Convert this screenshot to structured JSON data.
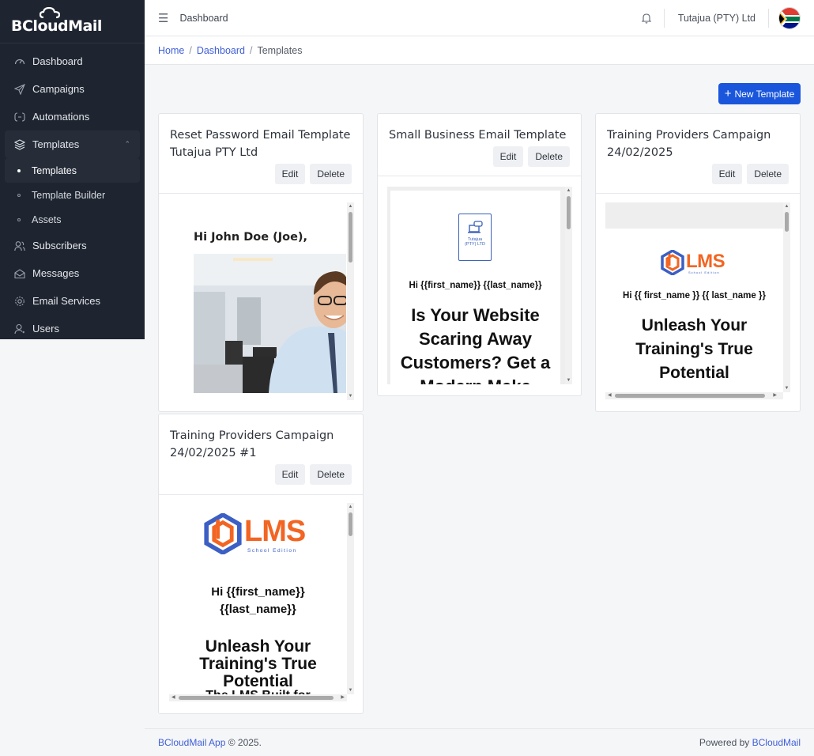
{
  "app": {
    "brand": "BCloudMail"
  },
  "sidebar": {
    "items": [
      {
        "label": "Dashboard",
        "icon": "dashboard-gauge-icon"
      },
      {
        "label": "Campaigns",
        "icon": "send-icon"
      },
      {
        "label": "Automations",
        "icon": "automation-icon"
      },
      {
        "label": "Templates",
        "icon": "layers-icon"
      },
      {
        "label": "Subscribers",
        "icon": "users-icon"
      },
      {
        "label": "Messages",
        "icon": "envelope-icon"
      },
      {
        "label": "Email Services",
        "icon": "gear-icon"
      },
      {
        "label": "Users",
        "icon": "user-icon"
      }
    ],
    "templates_sub": [
      {
        "label": "Templates"
      },
      {
        "label": "Template Builder"
      },
      {
        "label": "Assets"
      }
    ]
  },
  "topbar": {
    "title": "Dashboard",
    "company": "Tutajua (PTY) Ltd"
  },
  "breadcrumb": {
    "home": "Home",
    "dashboard": "Dashboard",
    "current": "Templates"
  },
  "actions": {
    "new_template": "New Template"
  },
  "cards": [
    {
      "title_line1": "Reset Password Email Template",
      "title_line2": "Tutajua PTY Ltd",
      "edit": "Edit",
      "delete": "Delete",
      "preview": {
        "greeting": "Hi John Doe (Joe),"
      }
    },
    {
      "title_line1": "Small Business Email Template",
      "edit": "Edit",
      "delete": "Delete",
      "preview": {
        "logo_line1": "Tutajua",
        "logo_line2": "(PTY) LTD",
        "greeting": "Hi {{first_name}} {{last_name}}",
        "headline_1": "Is Your Website",
        "headline_2": "Scaring Away",
        "headline_3": "Customers? Get a",
        "headline_4": "Modern Make"
      }
    },
    {
      "title_line1": "Training Providers Campaign",
      "title_line2": "24/02/2025",
      "edit": "Edit",
      "delete": "Delete",
      "preview": {
        "logo_text": "LMS",
        "logo_sub": "School Edition",
        "greeting": "Hi {{ first_name }} {{ last_name }}",
        "headline_1": "Unleash Your",
        "headline_2": "Training's True",
        "headline_3": "Potential"
      }
    },
    {
      "title_line1": "Training Providers Campaign",
      "title_line2": "24/02/2025 #1",
      "edit": "Edit",
      "delete": "Delete",
      "preview": {
        "logo_text": "LMS",
        "logo_sub": "School Edition",
        "greeting_1": "Hi {{first_name}}",
        "greeting_2": "{{last_name}}",
        "headline_1": "Unleash Your",
        "headline_2": "Training's True",
        "headline_3": "Potential",
        "subhead": "The LMS Built for"
      }
    }
  ],
  "footer": {
    "app_link": "BCloudMail App",
    "copyright": "© 2025.",
    "powered_by": "Powered by",
    "powered_link": "BCloudMail"
  },
  "colors": {
    "primary": "#1a56db",
    "sidebar_bg": "#1f2530",
    "link": "#3f5fd6",
    "lms_orange": "#f26522",
    "lms_blue": "#3b5fc4"
  }
}
